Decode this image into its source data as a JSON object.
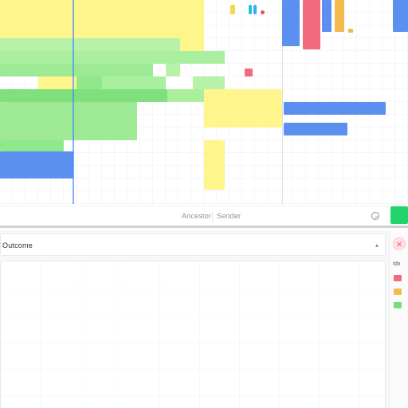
{
  "toolbar": {
    "label_left": "Ancestor",
    "label_right": "Sender"
  },
  "panel": {
    "title": "Outcome",
    "collapse_icon": "chevron-up-icon"
  },
  "right_sidebar": {
    "title": "Idx",
    "swatches": [
      {
        "name": "red",
        "color": "#f16b7c"
      },
      {
        "name": "orange",
        "color": "#f3bb4b"
      },
      {
        "name": "green",
        "color": "#78db7a"
      }
    ]
  },
  "colors": {
    "yellow": "#fff58d",
    "green": "#8fe88a",
    "green_light": "#b8f2aa",
    "blue": "#5b8ff0",
    "red": "#f16b7c",
    "orange": "#f3bb4b",
    "sky": "#3aa6ff",
    "accent": "#21d46b"
  }
}
